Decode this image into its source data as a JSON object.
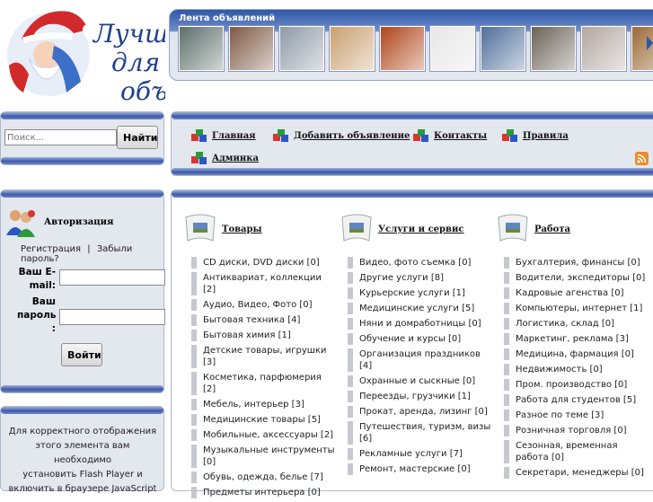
{
  "logo": {
    "slogan_line1": "Лучш",
    "slogan_line2": "для С",
    "slogan_line3": "объя"
  },
  "feed": {
    "title": "Лента объявлений",
    "thumbs": [
      "#5d6f6a",
      "#7e5a45",
      "#8f9aa6",
      "#c9a070",
      "#b0441a",
      "#e6e6e6",
      "#4f6e9a",
      "#6b6358",
      "#b2a6a0",
      "#9b6a35"
    ]
  },
  "search": {
    "placeholder": "Поиск...",
    "button": "Найти"
  },
  "nav": {
    "items": [
      "Главная",
      "Добавить объявление",
      "Контакты",
      "Правила",
      "Админка"
    ]
  },
  "auth": {
    "title": "Авторизация",
    "register": "Регистрация",
    "separator": "|",
    "forgot": "Забыли пароль?",
    "email_label_1": "Ваш E-",
    "email_label_2": "mail:",
    "pass_label_1": "Ваш",
    "pass_label_2": "пароль",
    "pass_label_3": ":",
    "login_button": "Войти"
  },
  "flash": {
    "line1": "Для корректного отображения",
    "line2": "этого элемента вам необходимо",
    "line3": "установить Flash Player и",
    "line4": "включить в браузере JavaScript"
  },
  "categories": [
    {
      "name": "Товары",
      "items": [
        "CD диски, DVD диски [0]",
        "Антиквариат, коллекции [2]",
        "Аудио, Видео, Фото [0]",
        "Бытовая техника [4]",
        "Бытовая химия [1]",
        "Детские товары, игрушки [3]",
        "Косметика, парфюмерия [2]",
        "Мебель, интерьер [3]",
        "Медицинские товары [5]",
        "Мобильные, аксессуары [2]",
        "Музыкальные инструменты [0]",
        "Обувь, одежда, белье [7]",
        "Предметы интерьера [0]"
      ]
    },
    {
      "name": "Услуги и сервис",
      "items": [
        "Видео, фото съемка [0]",
        "Другие услуги [8]",
        "Курьерские услуги [1]",
        "Медицинские услуги [5]",
        "Няни и домработницы [0]",
        "Обучение и курсы [0]",
        "Организация праздников [4]",
        "Охранные и сыскные [0]",
        "Переезды, грузчики [1]",
        "Прокат, аренда, лизинг [0]",
        "Путешествия, туризм, визы [6]",
        "Рекламные услуги [7]",
        "Ремонт, мастерские [0]"
      ]
    },
    {
      "name": "Работа",
      "items": [
        "Бухгалтерия, финансы [0]",
        "Водители, экспедиторы [0]",
        "Кадровые агенства [0]",
        "Компьютеры, интернет [1]",
        "Логистика, склад [0]",
        "Маркетинг, реклама [3]",
        "Медицина, фармация [0]",
        "Недвижимость [0]",
        "Пром. производство [0]",
        "Работа для студентов [5]",
        "Разное по теме [3]",
        "Розничная торговля [0]",
        "Сезонная, временная работа [0]",
        "Секретари, менеджеры [0]"
      ]
    }
  ],
  "colors": {
    "bar_blue": "#3e5ba8",
    "panel_bg": "#e3e7ee",
    "rss": "#f08a24"
  }
}
